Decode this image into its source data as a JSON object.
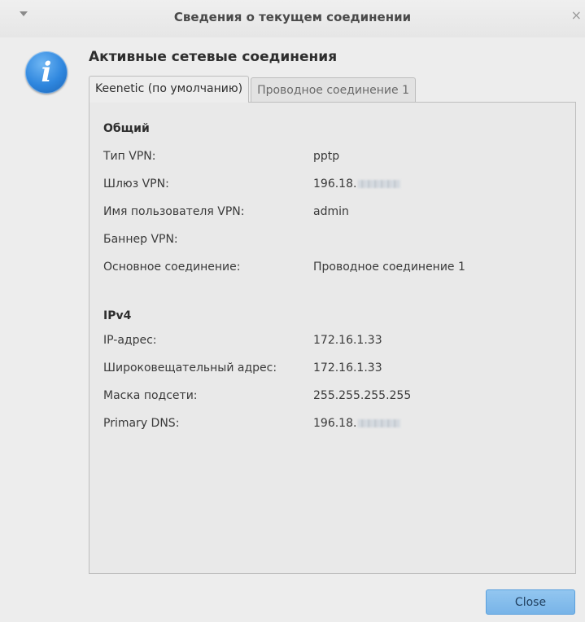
{
  "window": {
    "title": "Сведения о текущем соединении",
    "close_glyph": "×",
    "menu_icon": "chevron-down-icon"
  },
  "icon": {
    "name": "info-icon",
    "glyph": "i",
    "color": "#2e86de"
  },
  "heading": "Активные сетевые соединения",
  "tabs": [
    {
      "label": "Keenetic (по умолчанию)",
      "active": true
    },
    {
      "label": "Проводное соединение 1",
      "active": false
    }
  ],
  "sections": {
    "general": {
      "title": "Общий",
      "rows": [
        {
          "label": "Тип VPN:",
          "value": "pptp"
        },
        {
          "label": "Шлюз VPN:",
          "value": "196.18.",
          "redacted": true
        },
        {
          "label": "Имя пользователя VPN:",
          "value": "admin"
        },
        {
          "label": "Баннер VPN:",
          "value": ""
        },
        {
          "label": "Основное соединение:",
          "value": "Проводное соединение 1"
        }
      ]
    },
    "ipv4": {
      "title": "IPv4",
      "rows": [
        {
          "label": "IP-адрес:",
          "value": "172.16.1.33"
        },
        {
          "label": "Широковещательный адрес:",
          "value": "172.16.1.33"
        },
        {
          "label": "Маска подсети:",
          "value": "255.255.255.255"
        },
        {
          "label": "Primary DNS:",
          "value": "196.18.",
          "redacted": true
        }
      ]
    }
  },
  "buttons": {
    "close_label": "Close",
    "accent": "#78b4e8"
  }
}
